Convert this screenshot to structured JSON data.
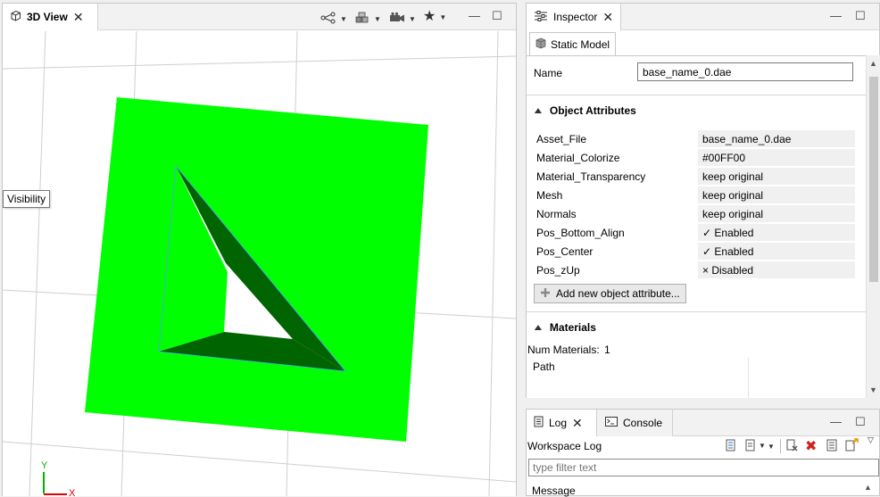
{
  "view3d": {
    "tab_label": "3D View",
    "tooltip": "Visibility",
    "axis_y": "Y",
    "axis_x": "X",
    "colors": {
      "model": "#00FF00",
      "inner": "#006400",
      "grid": "#cfcfcf"
    }
  },
  "inspector": {
    "tab_label": "Inspector",
    "subtab_label": "Static Model",
    "name_label": "Name",
    "name_value": "base_name_0.dae",
    "attributes_header": "Object Attributes",
    "attributes": [
      {
        "key": "Asset_File",
        "value": "base_name_0.dae"
      },
      {
        "key": "Material_Colorize",
        "value": "#00FF00"
      },
      {
        "key": "Material_Transparency",
        "value": "keep original"
      },
      {
        "key": "Mesh",
        "value": "keep original"
      },
      {
        "key": "Normals",
        "value": "keep original"
      },
      {
        "key": "Pos_Bottom_Align",
        "value": "✓ Enabled"
      },
      {
        "key": "Pos_Center",
        "value": "✓ Enabled"
      },
      {
        "key": "Pos_zUp",
        "value": "× Disabled"
      }
    ],
    "add_attribute_label": "Add new object attribute...",
    "materials_header": "Materials",
    "num_materials_label": "Num Materials:",
    "num_materials_value": "1",
    "path_label": "Path"
  },
  "log": {
    "tab_log": "Log",
    "tab_console": "Console",
    "workspace_label": "Workspace Log",
    "filter_placeholder": "type filter text",
    "message_header": "Message"
  }
}
